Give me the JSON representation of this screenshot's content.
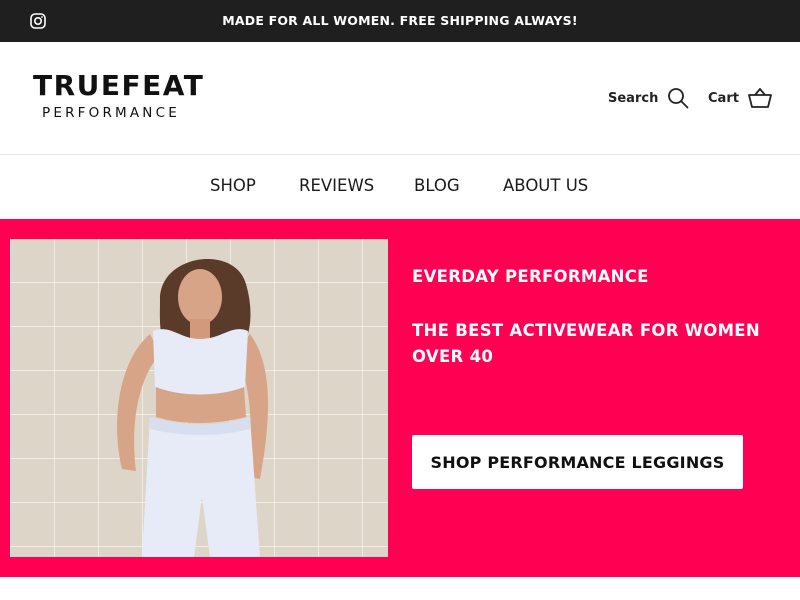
{
  "announcement": {
    "social_icon": "instagram-icon",
    "message": "MADE FOR ALL WOMEN. FREE SHIPPING ALWAYS!"
  },
  "header": {
    "logo": {
      "line1": "TRUEFEAT",
      "line2": "PERFORMANCE"
    },
    "search_label": "Search",
    "search_icon": "search-icon",
    "cart_label": "Cart",
    "cart_icon": "cart-basket-icon"
  },
  "nav": {
    "items": [
      {
        "label": "SHOP"
      },
      {
        "label": "REVIEWS"
      },
      {
        "label": "BLOG"
      },
      {
        "label": "ABOUT US"
      }
    ]
  },
  "hero": {
    "title": "EVERDAY PERFORMANCE",
    "subtitle": "THE BEST ACTIVEWEAR FOR WOMEN OVER 40",
    "cta_label": "SHOP PERFORMANCE LEGGINGS",
    "image_subject": "woman-in-white-activewear-photo"
  },
  "colors": {
    "announcement_bg": "#1f1f1f",
    "hero_bg": "#ff0053",
    "button_bg": "#ffffff",
    "text_dark": "#111111"
  }
}
